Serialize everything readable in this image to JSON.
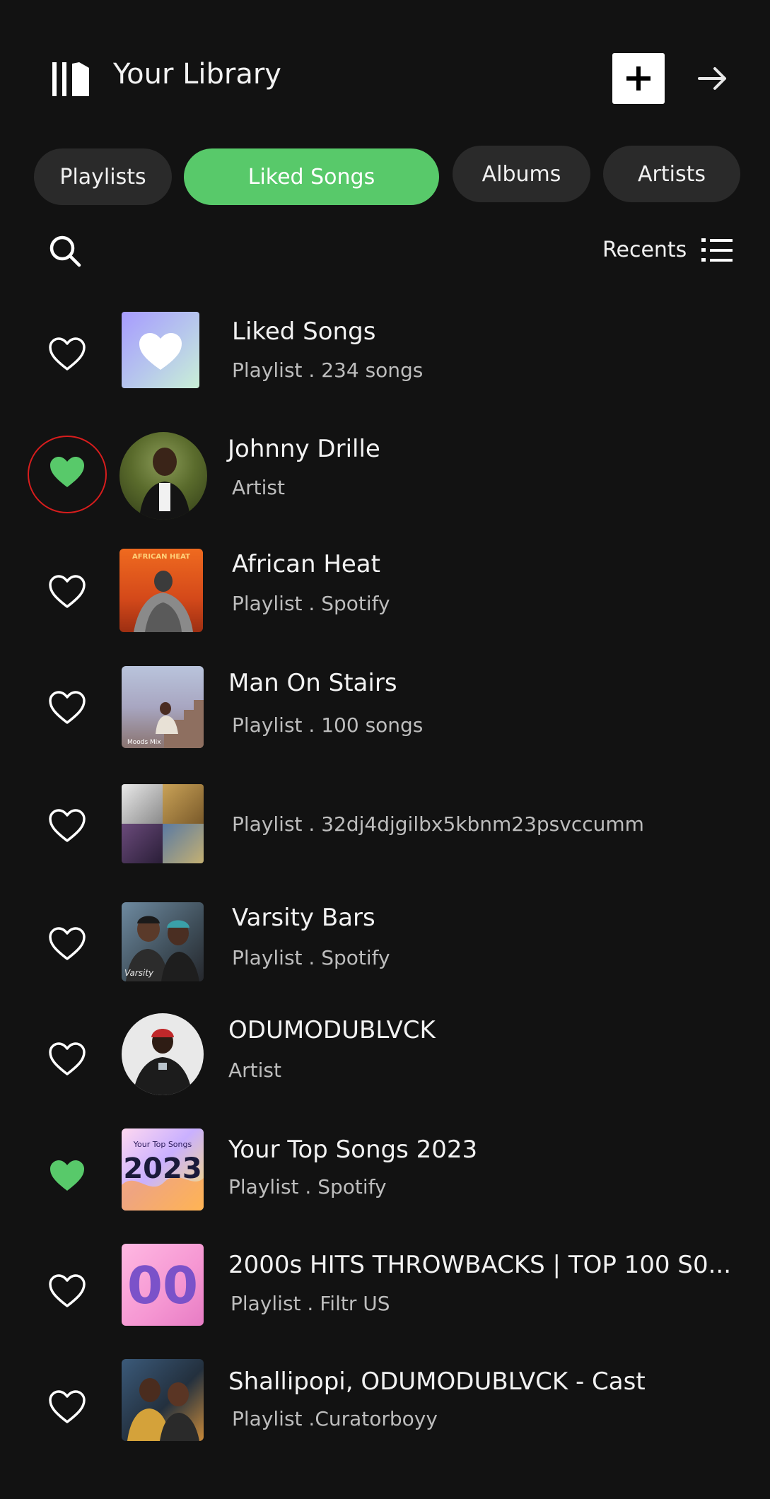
{
  "header": {
    "title": "Your Library",
    "library_icon": "library-icon",
    "add_icon": "plus-icon",
    "arrow_icon": "arrow-right-icon"
  },
  "filters": [
    {
      "label": "Playlists",
      "active": false
    },
    {
      "label": "Liked Songs",
      "active": true
    },
    {
      "label": "Albums",
      "active": false
    },
    {
      "label": "Artists",
      "active": false
    }
  ],
  "toolbar": {
    "search_icon": "search-icon",
    "sort_label": "Recents",
    "list_icon": "list-view-icon"
  },
  "colors": {
    "background": "#121212",
    "accent": "#58c96a",
    "chip": "#2a2a2a",
    "annotation": "#d81d1d"
  },
  "items": [
    {
      "title": "Liked Songs",
      "subtitle": "Playlist . 234 songs",
      "liked": false
    },
    {
      "title": "Johnny Drille",
      "subtitle": "Artist",
      "liked": true
    },
    {
      "title": "African Heat",
      "subtitle": "Playlist . Spotify",
      "liked": false
    },
    {
      "title": "Man On Stairs",
      "subtitle": "Playlist . 100 songs",
      "liked": false
    },
    {
      "title": "",
      "subtitle": "Playlist . 32dj4djgilbx5kbnm23psvccumm",
      "liked": false
    },
    {
      "title": "Varsity Bars",
      "subtitle": "Playlist . Spotify",
      "liked": false
    },
    {
      "title": "ODUMODUBLVCK",
      "subtitle": "Artist",
      "liked": false
    },
    {
      "title": "Your Top Songs 2023",
      "subtitle": "Playlist . Spotify",
      "liked": true
    },
    {
      "title": "2000s HITS THROWBACKS | TOP 100 S0...",
      "subtitle": "Playlist . Filtr US",
      "liked": false
    },
    {
      "title": "Shallipopi, ODUMODUBLVCK - Cast",
      "subtitle": "Playlist .Curatorboyy",
      "liked": false
    }
  ],
  "artwork_text": {
    "african_heat": "AFRICAN HEAT",
    "man_on_stairs": "Moods Mix",
    "varsity": "Varsity",
    "top_songs_small": "Your Top Songs",
    "top_songs_year": "2023",
    "hits": "00"
  }
}
